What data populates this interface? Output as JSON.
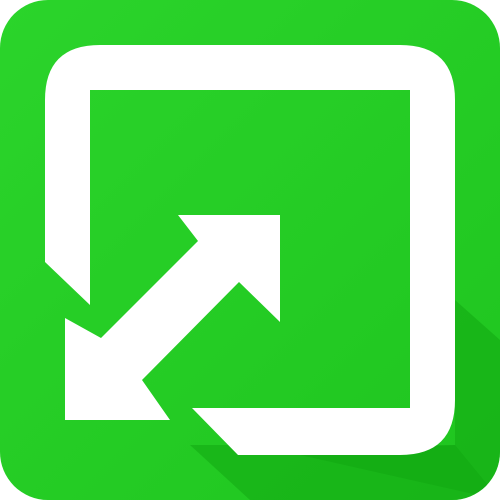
{
  "icon": {
    "name": "resize-icon",
    "colors": {
      "background": "#1fc51f",
      "background_light": "#2bd42b",
      "shadow": "#12a812",
      "foreground": "#ffffff"
    }
  }
}
